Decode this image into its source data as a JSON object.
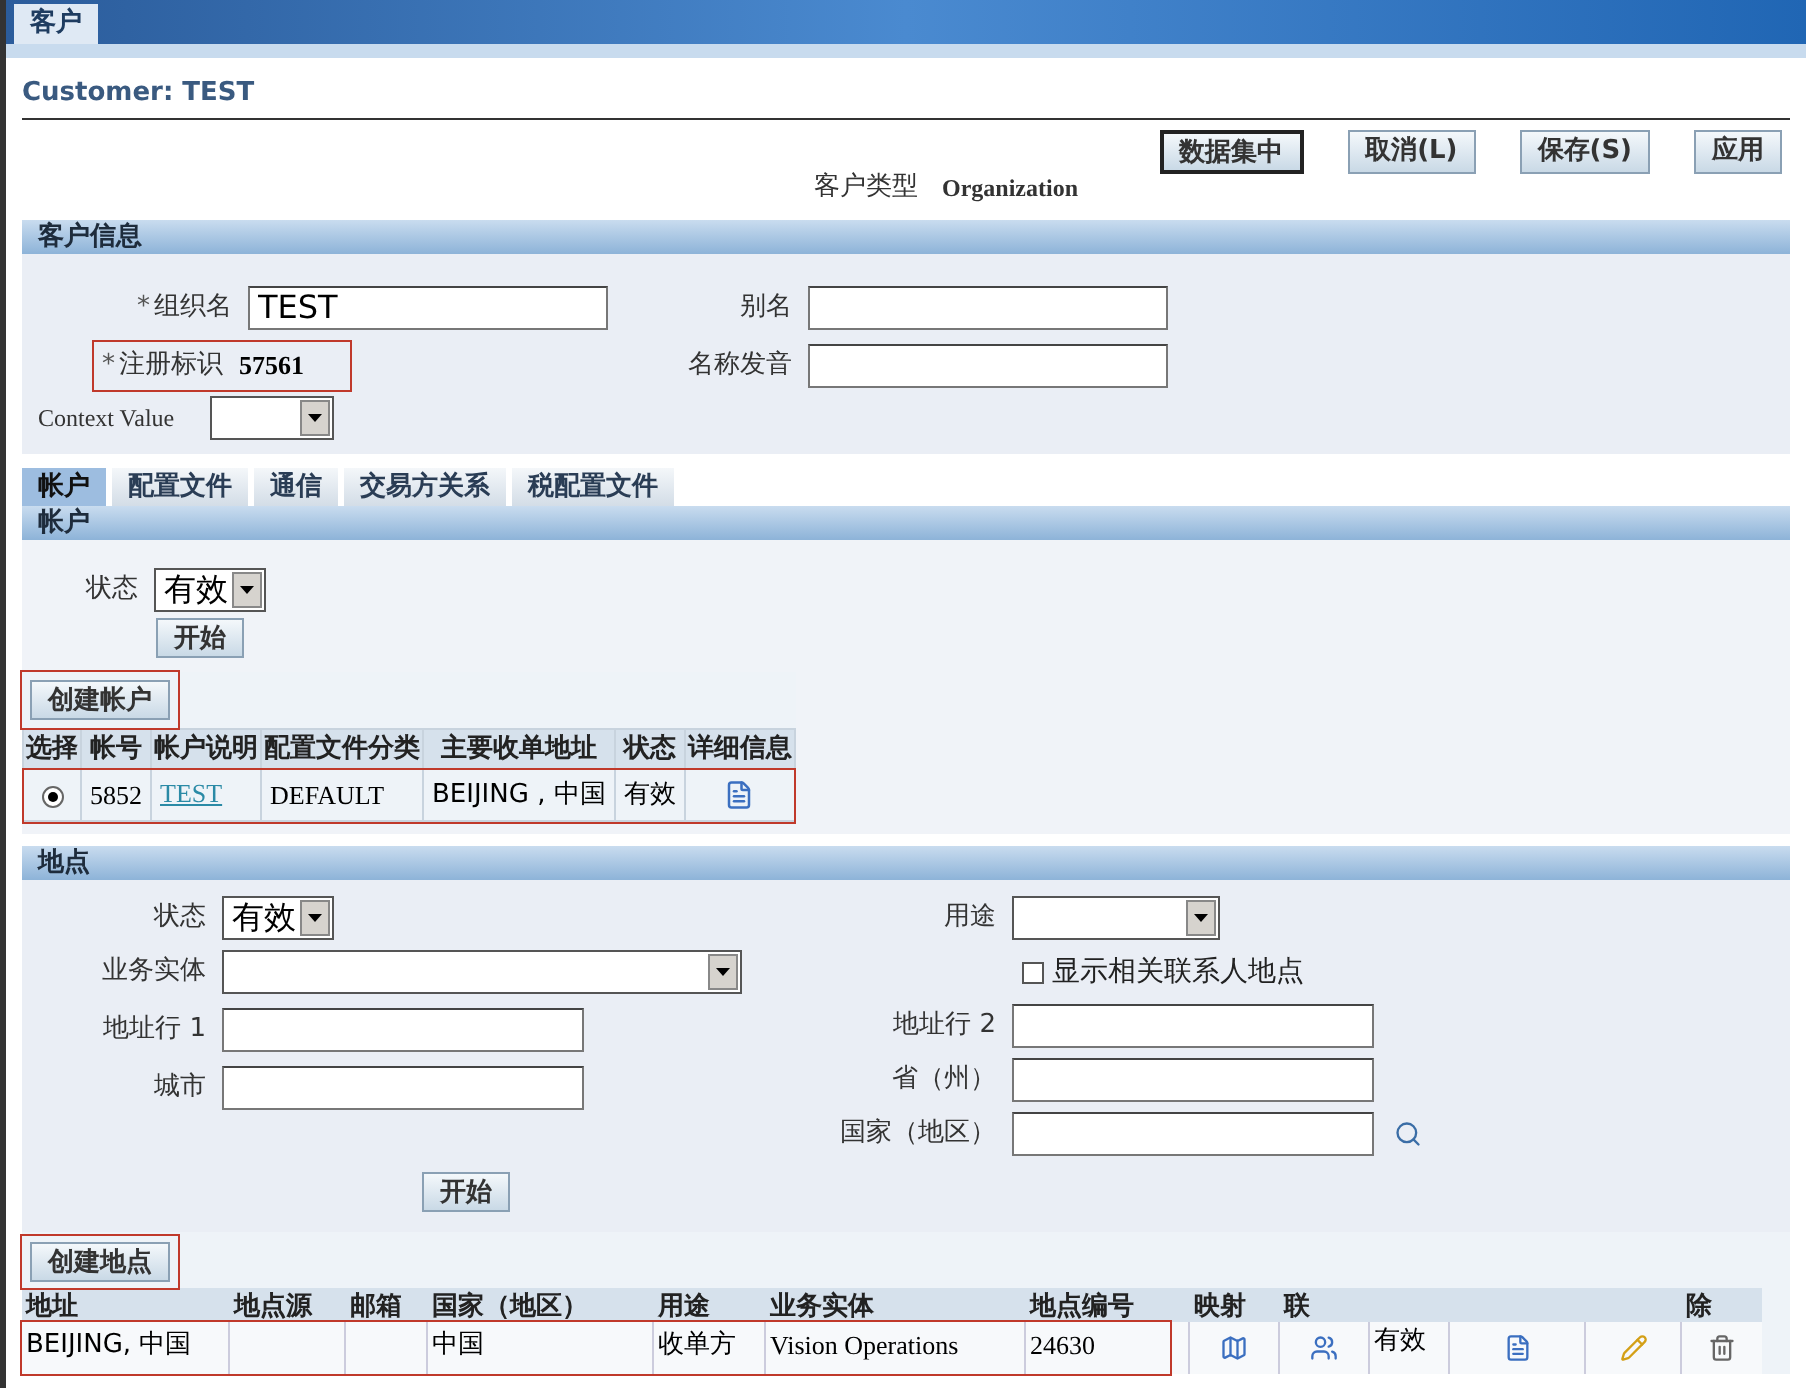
{
  "top_tab": {
    "label": "客户",
    "selected": true
  },
  "page_title": "Customer: TEST",
  "actions": [
    {
      "label": "数据集中",
      "primary": true
    },
    {
      "label": "取消(L)",
      "primary": false
    },
    {
      "label": "保存(S)",
      "primary": false
    },
    {
      "label": "应用",
      "primary": false
    }
  ],
  "customer_type": {
    "label": "客户类型",
    "value": "Organization"
  },
  "customer_info": {
    "title": "客户信息",
    "org_name": {
      "label": "组织名",
      "required_mark": "*",
      "value": "TEST"
    },
    "registry_id": {
      "label": "注册标识",
      "required_mark": "*",
      "value": "57561",
      "outlined": true
    },
    "alias": {
      "label": "别名"
    },
    "pronunciation": {
      "label": "名称发音"
    },
    "context_value": {
      "label": "Context Value"
    }
  },
  "tabs": [
    {
      "label": "帐户",
      "selected": true
    },
    {
      "label": "配置文件",
      "selected": false
    },
    {
      "label": "通信",
      "selected": false
    },
    {
      "label": "交易方关系",
      "selected": false
    },
    {
      "label": "税配置文件",
      "selected": false
    }
  ],
  "accounts": {
    "title": "帐户",
    "status": {
      "label": "状态",
      "value": "有效"
    },
    "go": "开始",
    "create": {
      "label": "创建帐户",
      "outlined": true
    },
    "columns": [
      "选择",
      "帐号",
      "帐户说明",
      "配置文件分类",
      "主要收单地址",
      "状态",
      "详细信息"
    ],
    "rows": [
      {
        "selected": true,
        "outlined": true,
        "number": "5852",
        "description": "TEST",
        "profile_class": "DEFAULT",
        "address": "BEIJING , 中国",
        "status": "有效"
      }
    ]
  },
  "sites": {
    "title": "地点",
    "status": {
      "label": "状态",
      "value": "有效"
    },
    "business_entity": {
      "label": "业务实体"
    },
    "address1": {
      "label": "地址行 1"
    },
    "city": {
      "label": "城市"
    },
    "purpose": {
      "label": "用途"
    },
    "show_contacts": {
      "label": "显示相关联系人地点",
      "checked": false
    },
    "address2": {
      "label": "地址行 2"
    },
    "province": {
      "label": "省（州）"
    },
    "country": {
      "label": "国家（地区）"
    },
    "go": "开始",
    "create": {
      "label": "创建地点",
      "outlined": true
    },
    "columns": [
      {
        "label": "地址"
      },
      {
        "label": "地点源"
      },
      {
        "label": "邮箱"
      },
      {
        "label": "国家（地区）"
      },
      {
        "label": "用途"
      },
      {
        "label": "业务实体"
      },
      {
        "label": "地点编号"
      },
      {
        "label": "映射"
      },
      {
        "label": "联"
      },
      {},
      {},
      {},
      {
        "label": "除"
      }
    ],
    "rows": [
      {
        "outlined": true,
        "address": "BEIJING, 中国",
        "country": "中国",
        "purpose": "收单方",
        "entity": "Vision Operations",
        "site_number": "24630",
        "status": "有效"
      }
    ]
  }
}
